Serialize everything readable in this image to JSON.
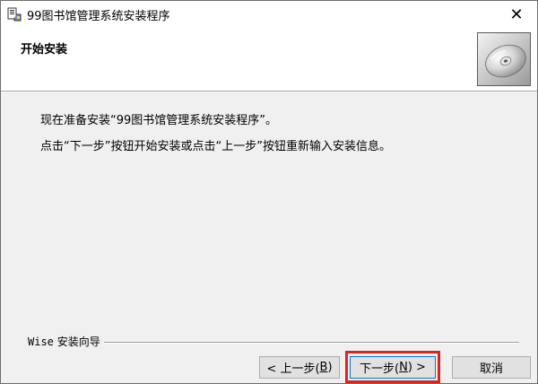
{
  "window": {
    "title": "99图书馆管理系统安装程序",
    "close_glyph": "✕",
    "icon": "installer-app-icon"
  },
  "header": {
    "title": "开始安装",
    "icon": "cd-disc-icon"
  },
  "body": {
    "line1": "现在准备安装“99图书馆管理系统安装程序”。",
    "line2": "点击“下一步”按钮开始安装或点击“上一步”按钮重新输入安装信息。"
  },
  "footer": {
    "group_label_prefix": "Wise",
    "group_label_suffix": " 安装向导"
  },
  "buttons": {
    "back_prefix": "< 上一步(",
    "back_key": "B",
    "back_suffix": ")",
    "next_prefix": "下一步(",
    "next_key": "N",
    "next_suffix": ") >",
    "cancel": "取消"
  },
  "colors": {
    "highlight": "#d9261c",
    "focus_border": "#0078d7",
    "button_bg": "#e1e1e1",
    "dialog_bg": "#f0f0f0"
  }
}
